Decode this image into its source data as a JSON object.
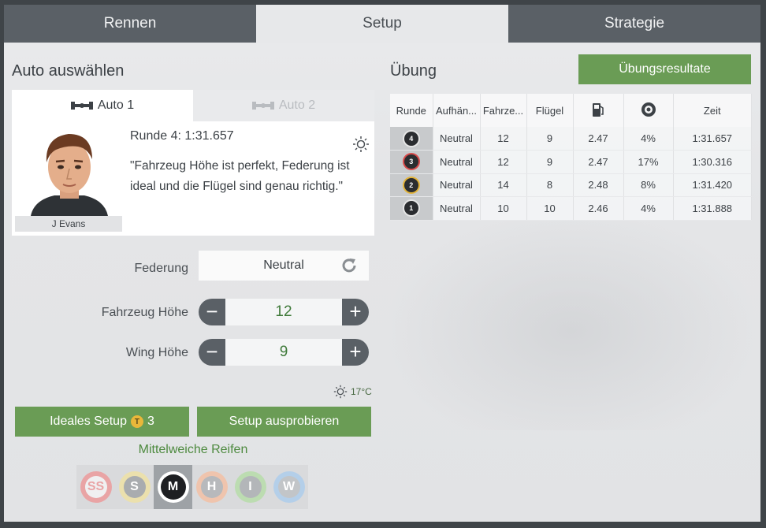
{
  "tabs": [
    {
      "label": "Rennen",
      "active": false
    },
    {
      "label": "Setup",
      "active": true
    },
    {
      "label": "Strategie",
      "active": false
    }
  ],
  "left": {
    "title": "Auto auswählen",
    "car_tabs": [
      {
        "label": "Auto 1",
        "active": true
      },
      {
        "label": "Auto 2",
        "active": false
      }
    ],
    "driver_name": "J Evans",
    "lap_info": "Runde 4: 1:31.657",
    "feedback": "\"Fahrzeug Höhe ist perfekt, Federung ist ideal und die Flügel sind genau richtig.\"",
    "weather_icon": "sun-icon"
  },
  "controls": {
    "suspension_label": "Federung",
    "suspension_value": "Neutral",
    "ride_height_label": "Fahrzeug Höhe",
    "ride_height_value": "12",
    "wing_label": "Wing Höhe",
    "wing_value": "9",
    "minus": "−",
    "plus": "+"
  },
  "temperature": "17°C",
  "buttons": {
    "ideal_setup": "Ideales Setup",
    "ideal_setup_cost": "3",
    "coin_symbol": "T",
    "try_setup": "Setup ausprobieren"
  },
  "tyre_label": "Mittelweiche Reifen",
  "tyres": [
    {
      "code": "SS",
      "color": "#e0676a",
      "selected": false
    },
    {
      "code": "S",
      "color": "#e0cf7a",
      "selected": false
    },
    {
      "code": "M",
      "color": "#1e1f22",
      "selected": true
    },
    {
      "code": "H",
      "color": "#e7a07a",
      "selected": false
    },
    {
      "code": "I",
      "color": "#8fc07e",
      "selected": false
    },
    {
      "code": "W",
      "color": "#7fb0e0",
      "selected": false
    }
  ],
  "practice": {
    "title": "Übung",
    "results_button": "Übungsresultate",
    "columns": [
      "Runde",
      "Aufhän...",
      "Fahrze...",
      "Flügel",
      "fuel-icon",
      "tyre-icon",
      "Zeit"
    ],
    "rows": [
      {
        "lap": "4",
        "tyre_color": "#2b2d30",
        "ring": "#8a8c90",
        "susp": "Neutral",
        "height": "12",
        "wing": "9",
        "fuel": "2.47",
        "wear": "4%",
        "time": "1:31.657"
      },
      {
        "lap": "3",
        "tyre_color": "#d94a4a",
        "ring": "#d94a4a",
        "susp": "Neutral",
        "height": "12",
        "wing": "9",
        "fuel": "2.47",
        "wear": "17%",
        "time": "1:30.316"
      },
      {
        "lap": "2",
        "tyre_color": "#e3b43a",
        "ring": "#e3b43a",
        "susp": "Neutral",
        "height": "14",
        "wing": "8",
        "fuel": "2.48",
        "wear": "8%",
        "time": "1:31.420"
      },
      {
        "lap": "1",
        "tyre_color": "#2b2d30",
        "ring": "#8a8c90",
        "susp": "Neutral",
        "height": "10",
        "wing": "10",
        "fuel": "2.46",
        "wear": "4%",
        "time": "1:31.888"
      }
    ]
  }
}
